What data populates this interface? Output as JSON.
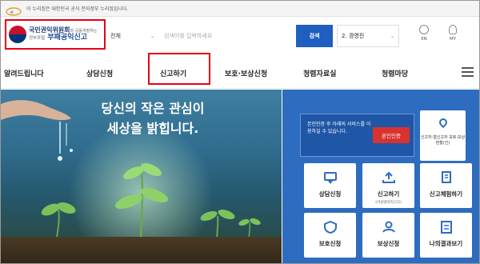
{
  "notice": {
    "text": "이 누리집은 대한민국 공식 전자정부 누리집입니다."
  },
  "logo": {
    "line1": "국민권익위원회",
    "line1_small": "와 공동개발하는",
    "line2_small": "정부포털",
    "line2": "부패공익신고"
  },
  "search": {
    "scope": "전체",
    "placeholder": "검색어를 입력하세요",
    "button": "검색",
    "region": "2. 경영진"
  },
  "util": {
    "en": "EN",
    "my": "MY"
  },
  "nav": {
    "items": [
      "알려드립니다",
      "상담신청",
      "신고하기",
      "보호·보상신청",
      "청렴자료실",
      "청렴마당"
    ]
  },
  "hero": {
    "line1": "당신의 작은 관심이",
    "line2": "세상을 밝힙니다."
  },
  "panel": {
    "auth_text": "본인인증 후 아래의 서비스를 이용하실 수 있습니다.",
    "auth_button": "본인인증",
    "status_card": "신고자·협신고자 보호·보상현황(인)",
    "cards": [
      {
        "label": "상담신청",
        "sub": ""
      },
      {
        "label": "신고하기",
        "sub": "(비실명대리신고)"
      },
      {
        "label": "신고체험하기",
        "sub": ""
      },
      {
        "label": "보호신청",
        "sub": ""
      },
      {
        "label": "보상신청",
        "sub": ""
      },
      {
        "label": "나의결과보기",
        "sub": ""
      }
    ]
  },
  "colors": {
    "brand_blue": "#1f5fbf",
    "highlight_red": "#e60012",
    "panel_blue": "#2e6cbf"
  }
}
